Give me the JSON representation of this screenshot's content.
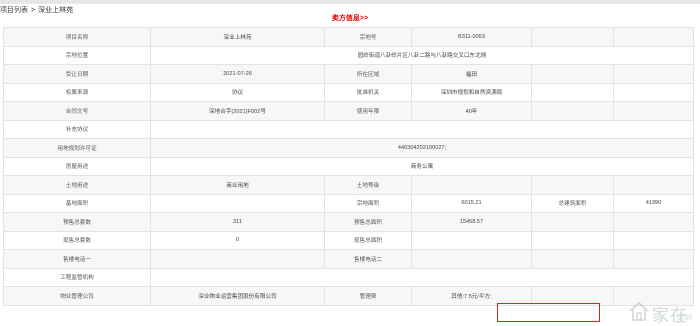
{
  "breadcrumb": {
    "parent": "项目列表",
    "separator": ">",
    "current": "深业上林苑"
  },
  "section": {
    "title": "卖方信息>>"
  },
  "rows": [
    [
      "项目名称",
      "深业上林苑",
      "宗地号",
      "B311-0053",
      "",
      ""
    ],
    [
      "宗地位置",
      "园岭街道八卦岭片区八卦二路与八卦路交叉口东北侧"
    ],
    [
      "受让日期",
      "2021-07-26",
      "所在区域",
      "福田",
      "",
      ""
    ],
    [
      "权属来源",
      "协议",
      "批准机关",
      "深圳市规划和自然资源局",
      "",
      ""
    ],
    [
      "合同文号",
      "深地合字(2021)F002号",
      "使用年限",
      "40年",
      "",
      ""
    ],
    [
      "补充协议",
      ""
    ],
    [
      "用地规划许可证",
      "440304202100027;"
    ],
    [
      "房屋用途",
      "商务公寓"
    ],
    [
      "土地用途",
      "商业用地",
      "土地等级",
      "",
      "",
      ""
    ],
    [
      "基地面积",
      "",
      "宗地面积",
      "6015.21",
      "总建筑面积",
      "41990"
    ],
    [
      "预售总套数",
      "311",
      "预售总面积",
      "15458.57",
      "",
      ""
    ],
    [
      "现售总套数",
      "0",
      "现售总面积",
      "",
      "",
      ""
    ],
    [
      "售楼电话一",
      "",
      "售楼电话二",
      "",
      "",
      ""
    ],
    [
      "工程监管机构",
      ""
    ],
    [
      "物业管理公司",
      "深业物业运营集团股份有限公司",
      "管理费",
      "其他:7.5元/平方;",
      "",
      ""
    ]
  ],
  "highlight": {
    "color": "#e02020"
  },
  "watermark": {
    "text": "家在",
    "sub": "深圳"
  }
}
